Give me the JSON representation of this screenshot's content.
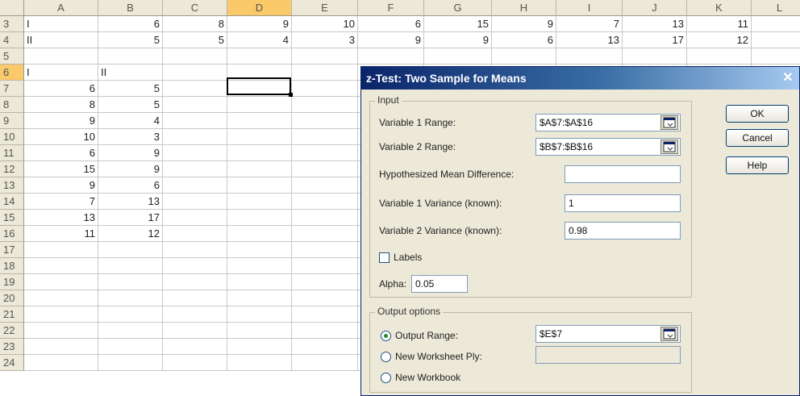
{
  "spreadsheet": {
    "columns": [
      "A",
      "B",
      "C",
      "D",
      "E",
      "F",
      "G",
      "H",
      "I",
      "J",
      "K",
      "L"
    ],
    "selected_column": "D",
    "selected_row": "6",
    "rows": [
      {
        "num": "3",
        "cells": [
          "I",
          "6",
          "8",
          "9",
          "10",
          "6",
          "15",
          "9",
          "7",
          "13",
          "11",
          ""
        ]
      },
      {
        "num": "4",
        "cells": [
          "II",
          "5",
          "5",
          "4",
          "3",
          "9",
          "9",
          "6",
          "13",
          "17",
          "12",
          ""
        ]
      },
      {
        "num": "5",
        "cells": [
          "",
          "",
          "",
          "",
          "",
          "",
          "",
          "",
          "",
          "",
          "",
          ""
        ]
      },
      {
        "num": "6",
        "cells": [
          "I",
          "II",
          "",
          "",
          "",
          "",
          "",
          "",
          "",
          "",
          "",
          ""
        ]
      },
      {
        "num": "7",
        "cells": [
          "6",
          "5",
          "",
          "",
          "",
          "",
          "",
          "",
          "",
          "",
          "",
          ""
        ]
      },
      {
        "num": "8",
        "cells": [
          "8",
          "5",
          "",
          "",
          "",
          "",
          "",
          "",
          "",
          "",
          "",
          ""
        ]
      },
      {
        "num": "9",
        "cells": [
          "9",
          "4",
          "",
          "",
          "",
          "",
          "",
          "",
          "",
          "",
          "",
          ""
        ]
      },
      {
        "num": "10",
        "cells": [
          "10",
          "3",
          "",
          "",
          "",
          "",
          "",
          "",
          "",
          "",
          "",
          ""
        ]
      },
      {
        "num": "11",
        "cells": [
          "6",
          "9",
          "",
          "",
          "",
          "",
          "",
          "",
          "",
          "",
          "",
          ""
        ]
      },
      {
        "num": "12",
        "cells": [
          "15",
          "9",
          "",
          "",
          "",
          "",
          "",
          "",
          "",
          "",
          "",
          ""
        ]
      },
      {
        "num": "13",
        "cells": [
          "9",
          "6",
          "",
          "",
          "",
          "",
          "",
          "",
          "",
          "",
          "",
          ""
        ]
      },
      {
        "num": "14",
        "cells": [
          "7",
          "13",
          "",
          "",
          "",
          "",
          "",
          "",
          "",
          "",
          "",
          ""
        ]
      },
      {
        "num": "15",
        "cells": [
          "13",
          "17",
          "",
          "",
          "",
          "",
          "",
          "",
          "",
          "",
          "",
          ""
        ]
      },
      {
        "num": "16",
        "cells": [
          "11",
          "12",
          "",
          "",
          "",
          "",
          "",
          "",
          "",
          "",
          "",
          ""
        ]
      },
      {
        "num": "17",
        "cells": [
          "",
          "",
          "",
          "",
          "",
          "",
          "",
          "",
          "",
          "",
          "",
          ""
        ]
      },
      {
        "num": "18",
        "cells": [
          "",
          "",
          "",
          "",
          "",
          "",
          "",
          "",
          "",
          "",
          "",
          ""
        ]
      },
      {
        "num": "19",
        "cells": [
          "",
          "",
          "",
          "",
          "",
          "",
          "",
          "",
          "",
          "",
          "",
          ""
        ]
      },
      {
        "num": "20",
        "cells": [
          "",
          "",
          "",
          "",
          "",
          "",
          "",
          "",
          "",
          "",
          "",
          ""
        ]
      },
      {
        "num": "21",
        "cells": [
          "",
          "",
          "",
          "",
          "",
          "",
          "",
          "",
          "",
          "",
          "",
          ""
        ]
      },
      {
        "num": "22",
        "cells": [
          "",
          "",
          "",
          "",
          "",
          "",
          "",
          "",
          "",
          "",
          "",
          ""
        ]
      },
      {
        "num": "23",
        "cells": [
          "",
          "",
          "",
          "",
          "",
          "",
          "",
          "",
          "",
          "",
          "",
          ""
        ]
      },
      {
        "num": "24",
        "cells": [
          "",
          "",
          "",
          "",
          "",
          "",
          "",
          "",
          "",
          "",
          "",
          ""
        ]
      }
    ]
  },
  "dialog": {
    "title": "z-Test: Two Sample for Means",
    "close_icon": "close-icon",
    "input_group_label": "Input",
    "var1_range_label": "Variable 1 Range:",
    "var1_range_value": "$A$7:$A$16",
    "var2_range_label": "Variable 2 Range:",
    "var2_range_value": "$B$7:$B$16",
    "hyp_mean_diff_label": "Hypothesized Mean Difference:",
    "hyp_mean_diff_value": "",
    "var1_variance_label": "Variable 1 Variance (known):",
    "var1_variance_value": "1",
    "var2_variance_label": "Variable 2 Variance (known):",
    "var2_variance_value": "0.98",
    "labels_checkbox_label": "Labels",
    "labels_checked": false,
    "alpha_label": "Alpha:",
    "alpha_value": "0.05",
    "output_group_label": "Output options",
    "output_range_label": "Output Range:",
    "output_range_value": "$E$7",
    "new_ply_label": "New Worksheet Ply:",
    "new_ply_value": "",
    "new_workbook_label": "New Workbook",
    "selected_output": "output-range",
    "ok_label": "OK",
    "cancel_label": "Cancel",
    "help_label": "Help",
    "accent_color": "#0a246a"
  }
}
